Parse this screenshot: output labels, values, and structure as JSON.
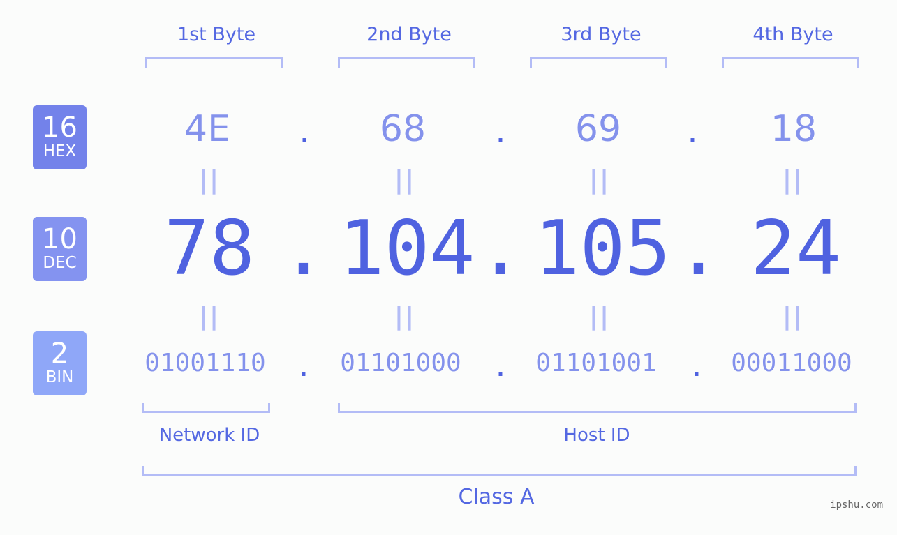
{
  "byte_headers": [
    "1st Byte",
    "2nd Byte",
    "3rd Byte",
    "4th Byte"
  ],
  "badges": {
    "hex": {
      "num": "16",
      "label": "HEX",
      "color": "#7382ea"
    },
    "dec": {
      "num": "10",
      "label": "DEC",
      "color": "#8493f0"
    },
    "bin": {
      "num": "2",
      "label": "BIN",
      "color": "#8fa7f8"
    }
  },
  "hex_values": [
    "4E",
    "68",
    "69",
    "18"
  ],
  "dec_values": [
    "78",
    "104",
    "105",
    "24"
  ],
  "bin_values": [
    "01001110",
    "01101000",
    "01101001",
    "00011000"
  ],
  "separator": ".",
  "equals": "||",
  "network_label": "Network ID",
  "host_label": "Host ID",
  "class_label": "Class A",
  "watermark": "ipshu.com",
  "colors": {
    "accent": "#4f62e0",
    "light": "#8492ec",
    "bracket": "#b3bcf6"
  }
}
